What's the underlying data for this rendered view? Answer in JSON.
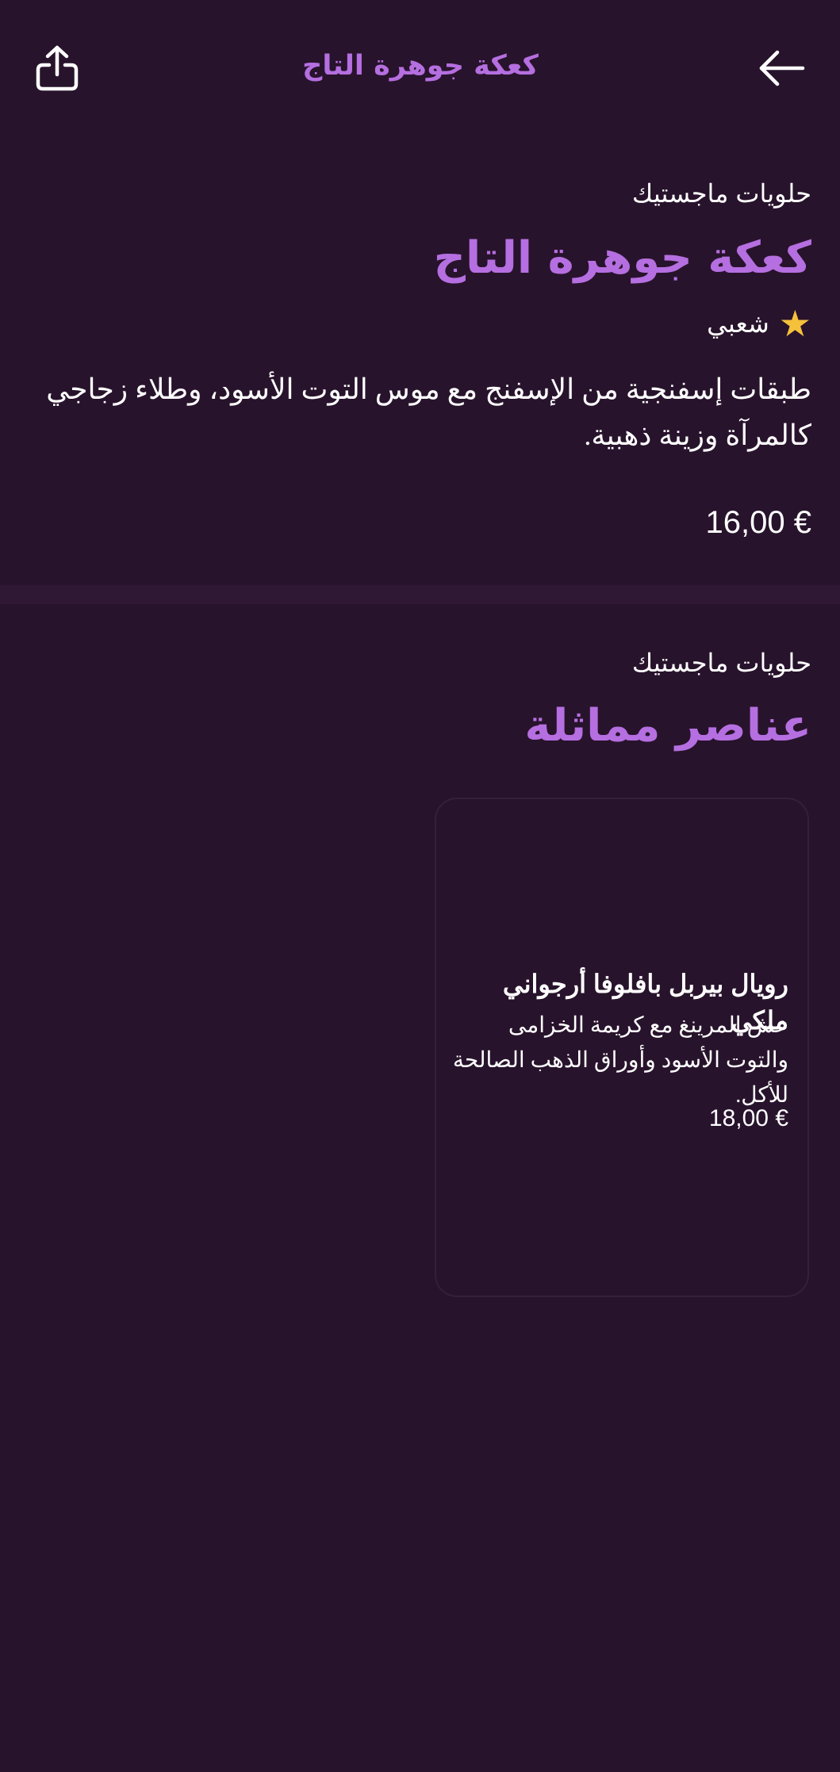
{
  "header": {
    "title": "كعكة جوهرة التاج",
    "share_icon": "share-icon",
    "back_icon": "arrow-left-icon"
  },
  "product": {
    "brand": "حلويات ماجستيك",
    "title": "كعكة جوهرة التاج",
    "badge": {
      "icon": "star-icon",
      "star": "★",
      "label": "شعبي",
      "color": "#f5c13b"
    },
    "description": "طبقات إسفنجية من الإسفنج مع موس التوت الأسود، وطلاء زجاجي كالمرآة وزينة ذهبية.",
    "price": "16,00 €"
  },
  "similar": {
    "brand": "حلويات ماجستيك",
    "title": "عناصر مماثلة",
    "items": [
      {
        "title": "رويال بيربل بافلوفا أرجواني ملكي",
        "description": "عش المرينغ مع كريمة الخزامى والتوت الأسود وأوراق الذهب الصالحة للأكل.",
        "price": "18,00 €"
      }
    ]
  },
  "colors": {
    "background": "#28132c",
    "accent": "#b56fe0",
    "divider": "#2e1833",
    "text": "#ffffff"
  }
}
